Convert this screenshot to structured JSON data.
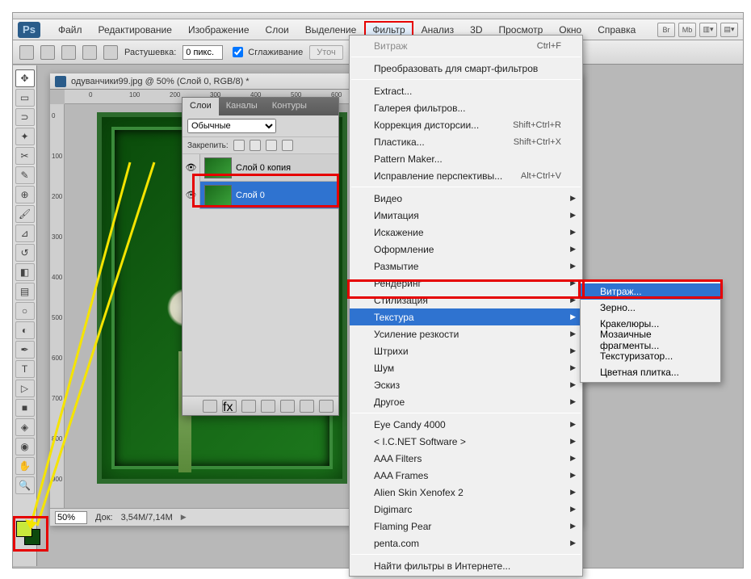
{
  "app": {
    "logo": "Ps"
  },
  "menubar": {
    "items": [
      "Файл",
      "Редактирование",
      "Изображение",
      "Слои",
      "Выделение",
      "Фильтр",
      "Анализ",
      "3D",
      "Просмотр",
      "Окно",
      "Справка"
    ],
    "active_index": 5,
    "right_badges": [
      "Br",
      "Mb"
    ]
  },
  "optbar": {
    "feather_label": "Растушевка:",
    "feather_value": "0 пикс.",
    "anti_alias": "Сглаживание",
    "refine": "Уточ"
  },
  "document": {
    "tab_title": "одуванчики99.jpg @ 50% (Слой 0, RGB/8) *",
    "zoom": "50%",
    "docsize_label": "Док:",
    "docsize": "3,54M/7,14M",
    "ruler_h": [
      "0",
      "100",
      "200",
      "300",
      "400",
      "500",
      "600"
    ],
    "ruler_v": [
      "0",
      "100",
      "200",
      "300",
      "400",
      "500",
      "600",
      "700",
      "800",
      "900"
    ]
  },
  "layers_panel": {
    "tabs": [
      "Слои",
      "Каналы",
      "Контуры"
    ],
    "blend_mode": "Обычные",
    "lock_label": "Закрепить:",
    "layers": [
      {
        "name": "Слой 0 копия",
        "selected": false
      },
      {
        "name": "Слой 0",
        "selected": true
      }
    ]
  },
  "filter_menu": {
    "top_item": {
      "label": "Витраж",
      "shortcut": "Ctrl+F"
    },
    "group1": [
      {
        "label": "Преобразовать для смарт-фильтров"
      }
    ],
    "group2": [
      {
        "label": "Extract..."
      },
      {
        "label": "Галерея фильтров..."
      },
      {
        "label": "Коррекция дисторсии...",
        "shortcut": "Shift+Ctrl+R"
      },
      {
        "label": "Пластика...",
        "shortcut": "Shift+Ctrl+X"
      },
      {
        "label": "Pattern Maker..."
      },
      {
        "label": "Исправление перспективы...",
        "shortcut": "Alt+Ctrl+V"
      }
    ],
    "group3": [
      {
        "label": "Видео",
        "sub": true
      },
      {
        "label": "Имитация",
        "sub": true
      },
      {
        "label": "Искажение",
        "sub": true
      },
      {
        "label": "Оформление",
        "sub": true
      },
      {
        "label": "Размытие",
        "sub": true
      },
      {
        "label": "Рендеринг",
        "sub": true
      },
      {
        "label": "Стилизация",
        "sub": true
      },
      {
        "label": "Текстура",
        "sub": true,
        "hover": true
      },
      {
        "label": "Усиление резкости",
        "sub": true
      },
      {
        "label": "Штрихи",
        "sub": true
      },
      {
        "label": "Шум",
        "sub": true
      },
      {
        "label": "Эскиз",
        "sub": true
      },
      {
        "label": "Другое",
        "sub": true
      }
    ],
    "group4": [
      {
        "label": "Eye Candy 4000",
        "sub": true
      },
      {
        "label": "< I.C.NET Software >",
        "sub": true
      },
      {
        "label": "AAA Filters",
        "sub": true
      },
      {
        "label": "AAA Frames",
        "sub": true
      },
      {
        "label": "Alien Skin Xenofex 2",
        "sub": true
      },
      {
        "label": "Digimarc",
        "sub": true
      },
      {
        "label": "Flaming Pear",
        "sub": true
      },
      {
        "label": "penta.com",
        "sub": true
      }
    ],
    "group5": [
      {
        "label": "Найти фильтры в Интернете..."
      }
    ]
  },
  "texture_submenu": [
    {
      "label": "Витраж...",
      "hover": true
    },
    {
      "label": "Зерно..."
    },
    {
      "label": "Кракелюры..."
    },
    {
      "label": "Мозаичные фрагменты..."
    },
    {
      "label": "Текстуризатор..."
    },
    {
      "label": "Цветная плитка..."
    }
  ],
  "colors": {
    "highlight": "#e60000",
    "menu_hover": "#2f73d0"
  }
}
